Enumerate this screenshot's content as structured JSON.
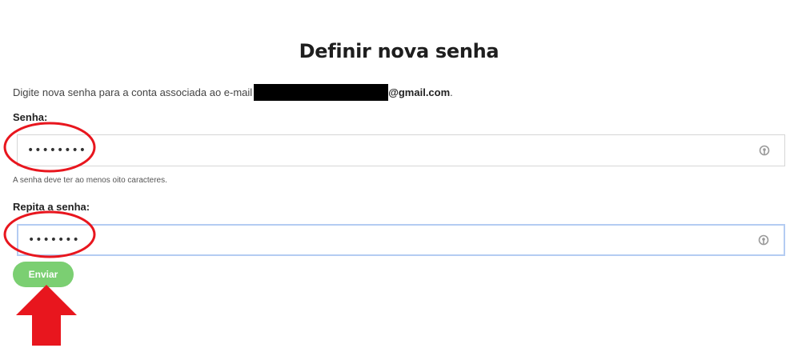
{
  "page": {
    "title": "Definir nova senha",
    "description_prefix": "Digite nova senha para a conta associada ao e-mail",
    "email_domain": "@gmail.com",
    "description_suffix": "."
  },
  "form": {
    "password_label": "Senha:",
    "password_value": "••••••••",
    "password_hint": "A senha deve ter ao menos oito caracteres.",
    "repeat_label": "Repita a senha:",
    "repeat_value": "•••••••",
    "submit_label": "Enviar"
  },
  "icons": {
    "field_icon": "password-manager-key-icon"
  },
  "colors": {
    "submit_bg": "#7bcf72",
    "focus_border": "#b4ccf2",
    "annotation_red": "#e8161e"
  }
}
